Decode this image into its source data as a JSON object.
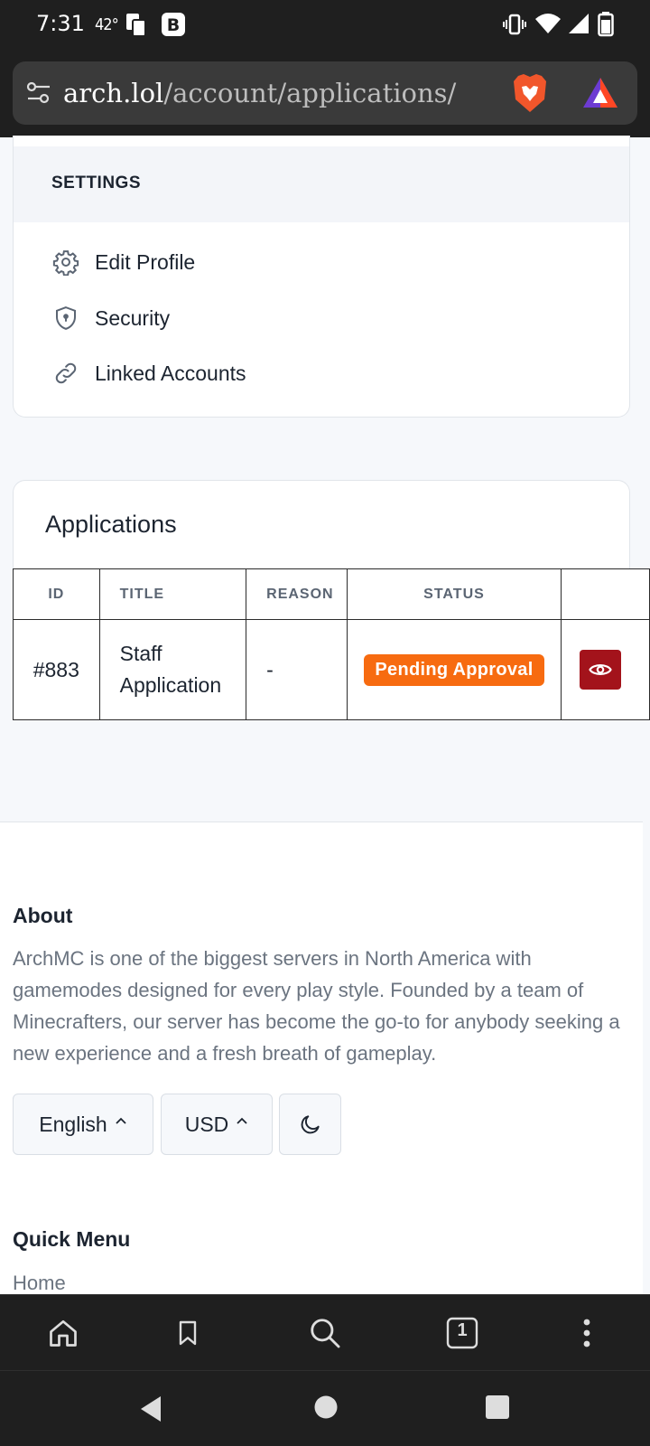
{
  "status_bar": {
    "time": "7:31",
    "temp": "42°"
  },
  "browser": {
    "url_host": "arch.lol",
    "url_path": "/account/applications/"
  },
  "settings": {
    "heading": "SETTINGS",
    "items": [
      {
        "label": "Edit Profile",
        "icon": "gear-icon"
      },
      {
        "label": "Security",
        "icon": "shield-icon"
      },
      {
        "label": "Linked Accounts",
        "icon": "link-icon"
      }
    ]
  },
  "applications": {
    "title": "Applications",
    "columns": [
      "ID",
      "TITLE",
      "REASON",
      "STATUS",
      ""
    ],
    "rows": [
      {
        "id": "#883",
        "title_line1": "Staff",
        "title_line2": "Application",
        "reason": "-",
        "status": "Pending Approval"
      }
    ],
    "status_color": "#f76b10",
    "action_color": "#a3131b"
  },
  "footer": {
    "about_title": "About",
    "about_text": "ArchMC is one of the biggest servers in North America with gamemodes designed for every play style. Founded by a team of Minecrafters, our server has become the go-to for anybody seeking a new experience and a fresh breath of gameplay.",
    "language": "English",
    "currency": "USD",
    "quick_menu_title": "Quick Menu",
    "quick_menu_first": "Home"
  },
  "toolbar": {
    "tab_count": "1"
  }
}
